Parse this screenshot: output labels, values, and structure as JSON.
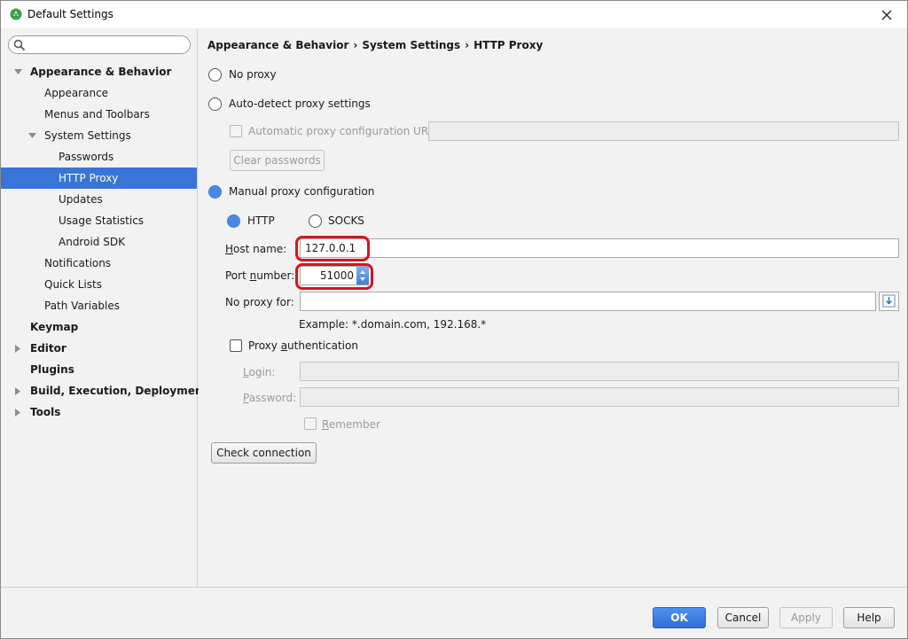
{
  "window": {
    "title": "Default Settings"
  },
  "sidebar": {
    "search_placeholder": "",
    "items": [
      {
        "label": "Appearance & Behavior",
        "bold": true,
        "level": 0,
        "arrow": "expanded"
      },
      {
        "label": "Appearance",
        "level": 1
      },
      {
        "label": "Menus and Toolbars",
        "level": 1
      },
      {
        "label": "System Settings",
        "level": 1,
        "arrow": "expanded"
      },
      {
        "label": "Passwords",
        "level": 2
      },
      {
        "label": "HTTP Proxy",
        "level": 2,
        "selected": true
      },
      {
        "label": "Updates",
        "level": 2
      },
      {
        "label": "Usage Statistics",
        "level": 2
      },
      {
        "label": "Android SDK",
        "level": 2
      },
      {
        "label": "Notifications",
        "level": 1
      },
      {
        "label": "Quick Lists",
        "level": 1
      },
      {
        "label": "Path Variables",
        "level": 1
      },
      {
        "label": "Keymap",
        "bold": true,
        "level": 0
      },
      {
        "label": "Editor",
        "bold": true,
        "level": 0,
        "arrow": "collapsed"
      },
      {
        "label": "Plugins",
        "bold": true,
        "level": 0
      },
      {
        "label": "Build, Execution, Deployment",
        "bold": true,
        "level": 0,
        "arrow": "collapsed"
      },
      {
        "label": "Tools",
        "bold": true,
        "level": 0,
        "arrow": "collapsed"
      }
    ]
  },
  "breadcrumb": {
    "part1": "Appearance & Behavior",
    "part2": "System Settings",
    "part3": "HTTP Proxy",
    "separator": "›"
  },
  "proxy": {
    "no_proxy_label": "No proxy",
    "auto_detect_label": "Auto-detect proxy settings",
    "auto_config_url_label": "Automatic proxy configuration URL:",
    "auto_config_url_value": "",
    "clear_passwords_label": "Clear passwords",
    "manual_label": "Manual proxy configuration",
    "selected_mode": "manual",
    "http_label": "HTTP",
    "socks_label": "SOCKS",
    "selected_protocol": "HTTP",
    "host_name_label_first": "H",
    "host_name_label_rest": "ost name:",
    "host_name_value": "127.0.0.1",
    "port_number_label_first": "Port ",
    "port_number_label_mn": "n",
    "port_number_label_rest": "umber:",
    "port_number_value": "51000",
    "no_proxy_for_label": "No proxy for:",
    "no_proxy_for_value": "",
    "example_text": "Example: *.domain.com, 192.168.*",
    "proxy_auth_label_first": "Proxy ",
    "proxy_auth_label_mn": "a",
    "proxy_auth_label_rest": "uthentication",
    "login_label_first": "L",
    "login_label_rest": "ogin:",
    "login_value": "",
    "password_label_first": "P",
    "password_label_rest": "assword:",
    "password_value": "",
    "remember_label_first": "R",
    "remember_label_rest": "emember",
    "check_connection_label": "Check connection"
  },
  "footer": {
    "ok_label": "OK",
    "cancel_label": "Cancel",
    "apply_label": "Apply",
    "help_label": "Help"
  },
  "colors": {
    "selection": "#3875d7",
    "highlight_annotation": "#d9141e",
    "primary_button": "#3c7bd9"
  }
}
